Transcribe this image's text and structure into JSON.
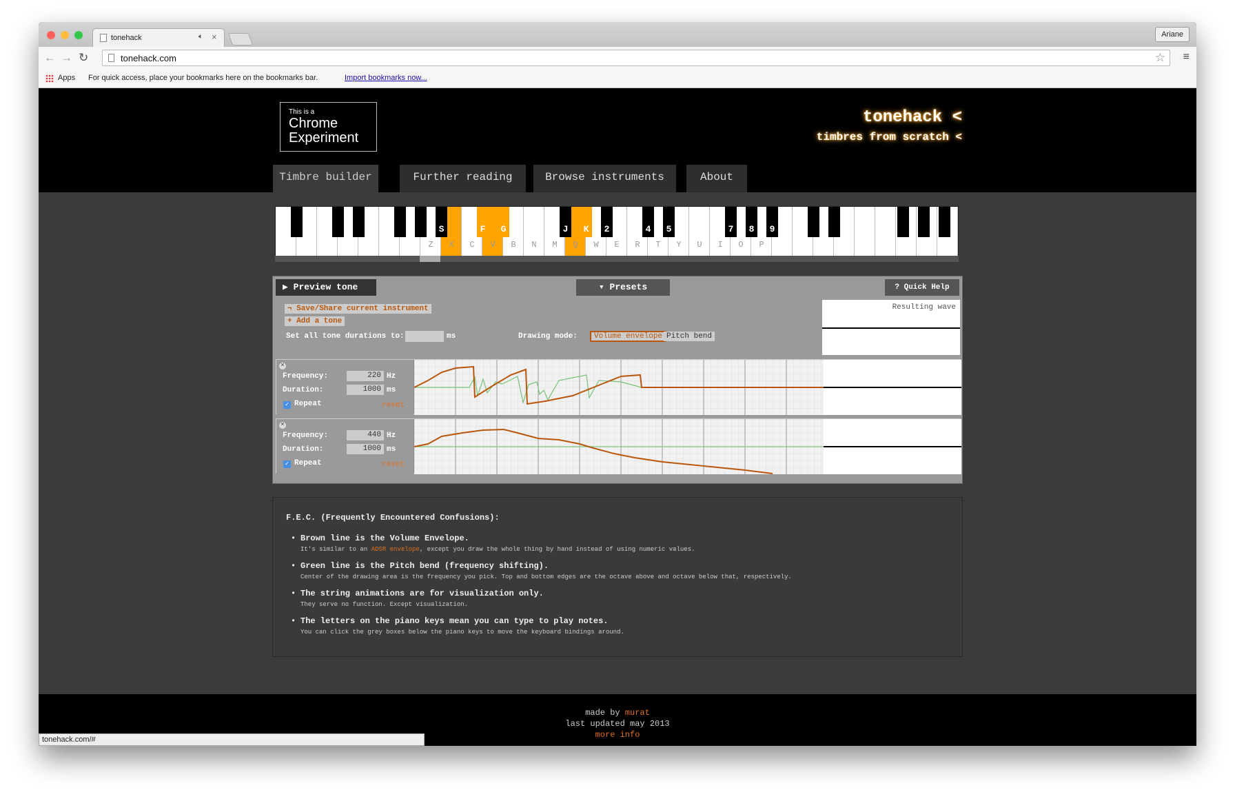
{
  "browser": {
    "tab_title": "tonehack",
    "user": "Ariane",
    "url": "tonehack.com",
    "apps_label": "Apps",
    "bookmark_hint": "For quick access, place your bookmarks here on the bookmarks bar.",
    "import_link": "Import bookmarks now...",
    "status_url": "tonehack.com/#"
  },
  "header": {
    "ce_small": "This is a",
    "ce_line1": "Chrome",
    "ce_line2": "Experiment",
    "title": "tonehack <",
    "subtitle": "timbres from scratch <"
  },
  "nav": {
    "items": [
      "Timbre builder",
      "Further reading",
      "Browse instruments",
      "About"
    ]
  },
  "piano": {
    "black_labels": [
      "",
      "",
      "",
      "",
      "",
      "S",
      "F",
      "G",
      "J",
      "K",
      "2",
      "4",
      "5",
      "7",
      "8",
      "9",
      "",
      "",
      "",
      "",
      "",
      ""
    ],
    "white_labels": [
      "Z",
      "X",
      "C",
      "V",
      "B",
      "N",
      "M",
      "Q",
      "W",
      "E",
      "R",
      "T",
      "Y",
      "U",
      "I",
      "O",
      "P"
    ],
    "highlight_color": "#ffa400"
  },
  "panel": {
    "preview_label": "Preview tone",
    "presets_label": "Presets",
    "help_label": "Quick Help",
    "save_share": "Save/Share current instrument",
    "add_tone": "Add a tone",
    "duration_label": "Set all tone durations to:",
    "duration_unit": "ms",
    "drawing_mode_label": "Drawing mode:",
    "mode_volume": "Volume envelope",
    "mode_pitch": "Pitch bend",
    "resulting_wave": "Resulting wave",
    "tones": [
      {
        "freq_label": "Frequency:",
        "freq": "220",
        "freq_unit": "Hz",
        "dur_label": "Duration:",
        "dur": "1000",
        "dur_unit": "ms",
        "repeat": "Repeat",
        "reset": "reset"
      },
      {
        "freq_label": "Frequency:",
        "freq": "440",
        "freq_unit": "Hz",
        "dur_label": "Duration:",
        "dur": "1000",
        "dur_unit": "ms",
        "repeat": "Repeat",
        "reset": "reset"
      }
    ],
    "volume_color": "#b8570c",
    "pitch_color": "#79c27a"
  },
  "fec": {
    "title": "F.E.C. (Frequently Encountered Confusions):",
    "items": [
      {
        "main": "Brown line is the Volume Envelope.",
        "sub_pre": "It's similar to an ",
        "sub_link": "ADSR envelope",
        "sub_post": ", except you draw the whole thing by hand instead of using numeric values."
      },
      {
        "main": "Green line is the Pitch bend (frequency shifting).",
        "sub": "Center of the drawing area is the frequency you pick. Top and bottom edges are the octave above and octave below that, respectively."
      },
      {
        "main": "The string animations are for visualization only.",
        "sub": "They serve no function. Except visualization."
      },
      {
        "main": "The letters on the piano keys mean you can type to play notes.",
        "sub": "You can click the grey boxes below the piano keys to move the keyboard bindings around."
      }
    ]
  },
  "footer": {
    "made_by": "made by ",
    "author": "murat",
    "updated": "last updated may 2013",
    "more": "more info"
  }
}
